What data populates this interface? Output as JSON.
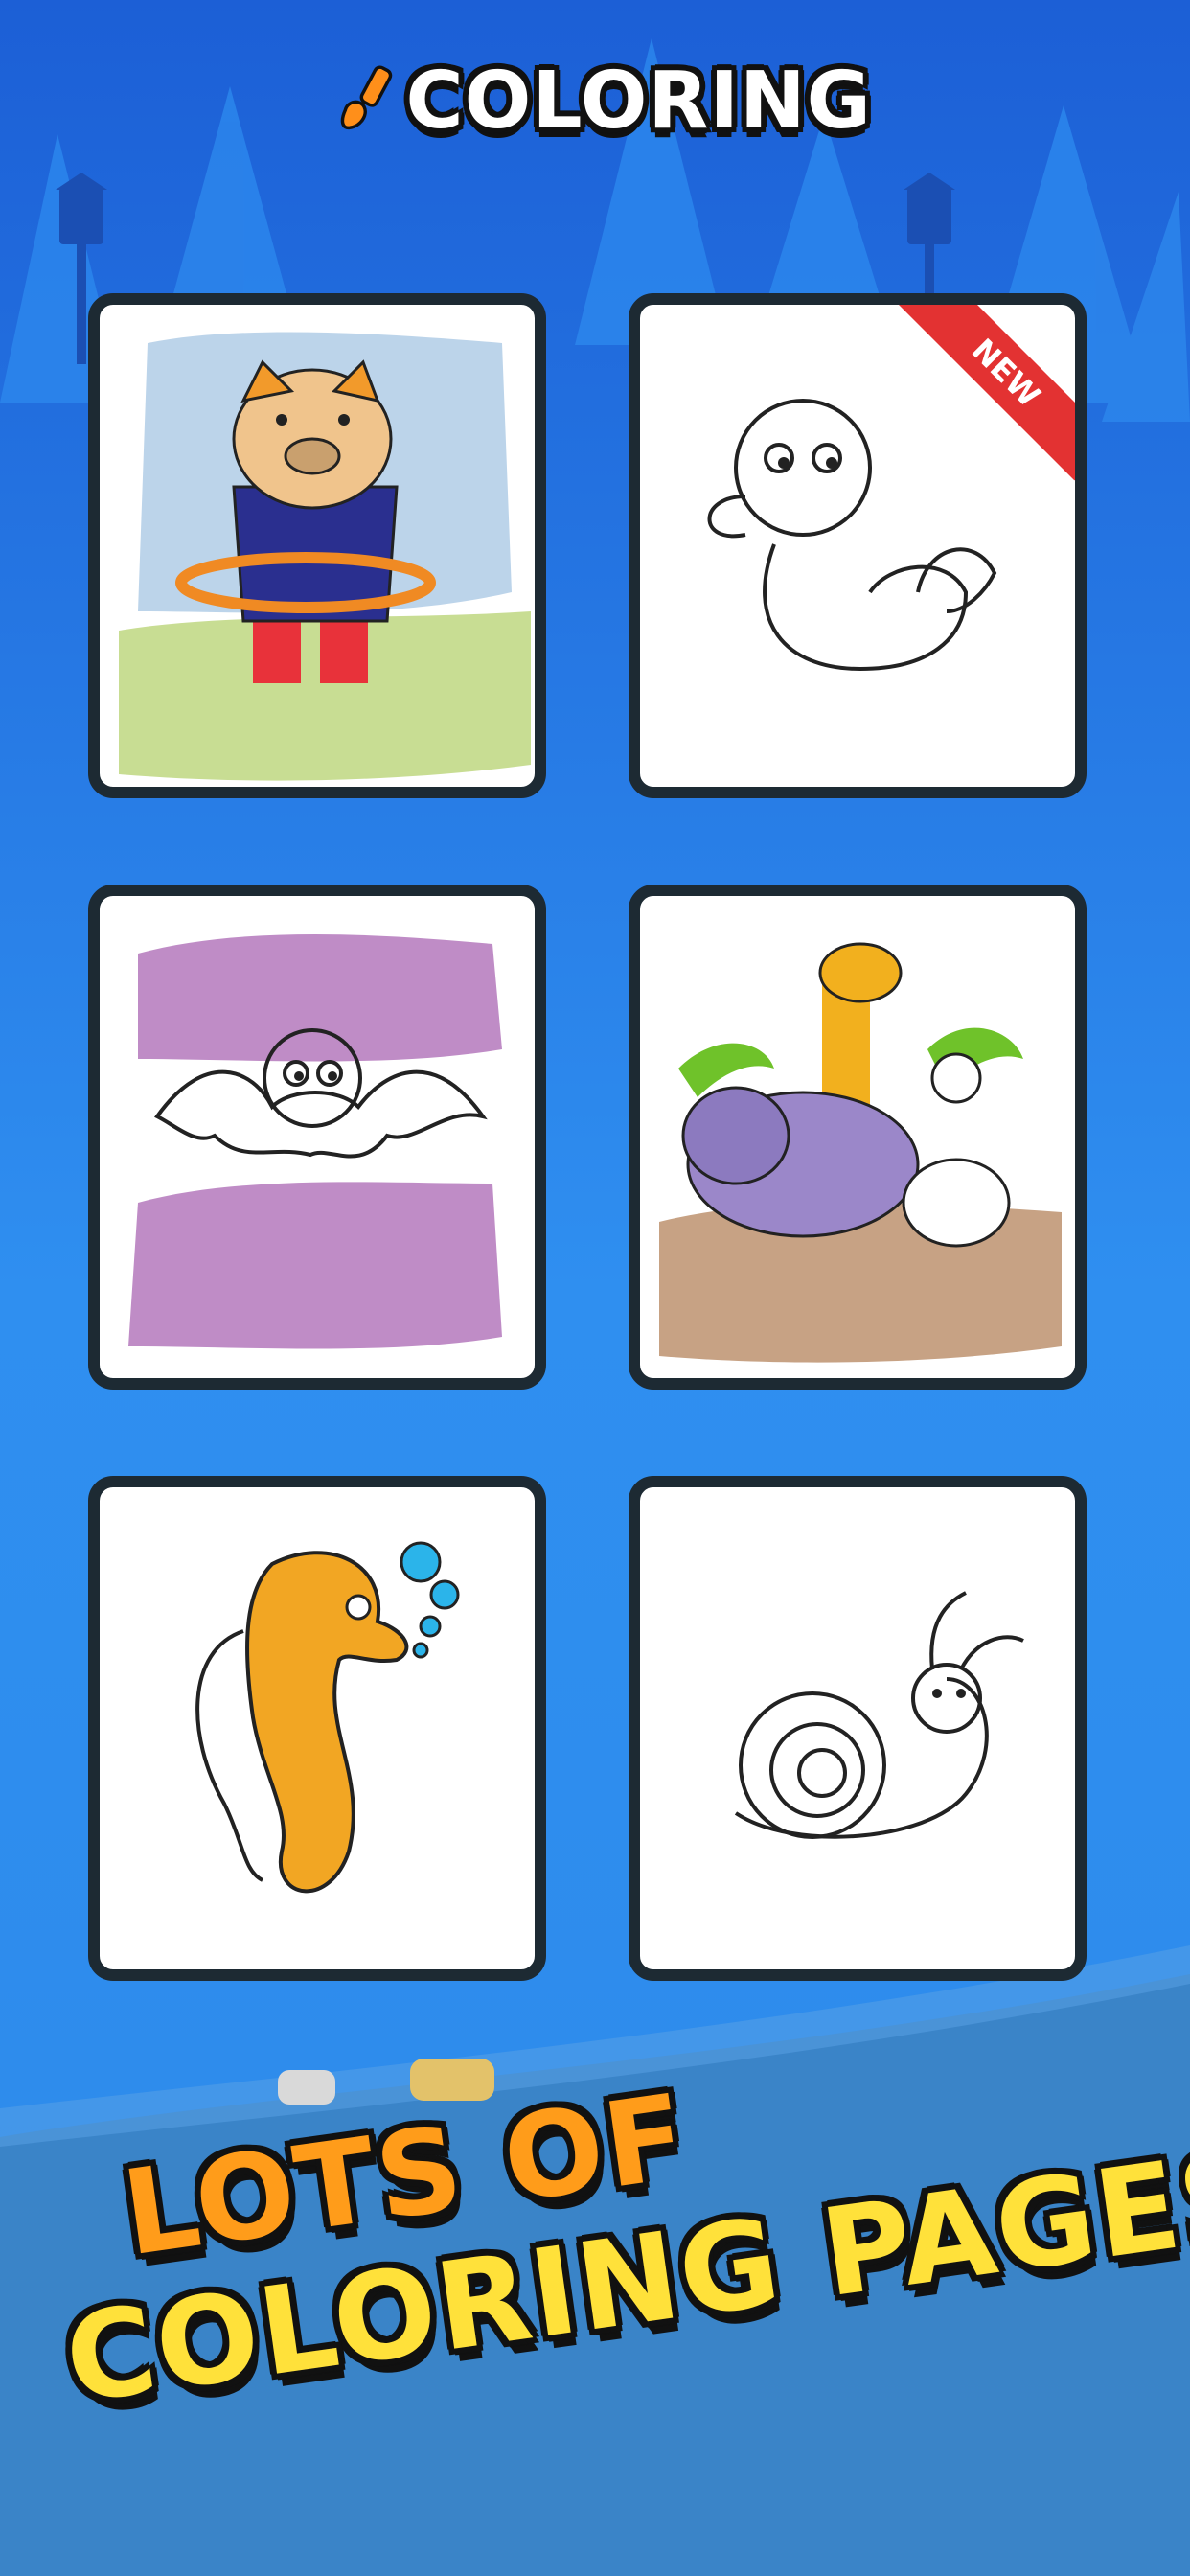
{
  "app": {
    "logo_text": "COLORING"
  },
  "colors": {
    "accent_orange": "#ff9c1a",
    "accent_yellow": "#ffe13a",
    "ribbon_red": "#e33232",
    "background_blue": "#2d8ff0"
  },
  "grid": {
    "cards": [
      {
        "subject": "pig with hula hoop",
        "colored": true,
        "badge": ""
      },
      {
        "subject": "duck",
        "colored": false,
        "badge": "NEW"
      },
      {
        "subject": "bat",
        "colored": true,
        "badge": ""
      },
      {
        "subject": "jungle animals",
        "colored": true,
        "badge": ""
      },
      {
        "subject": "seahorse",
        "colored": true,
        "badge": ""
      },
      {
        "subject": "snail",
        "colored": false,
        "badge": ""
      }
    ]
  },
  "headline": {
    "line1": "LOTS OF",
    "line2": "COLORING PAGES"
  }
}
